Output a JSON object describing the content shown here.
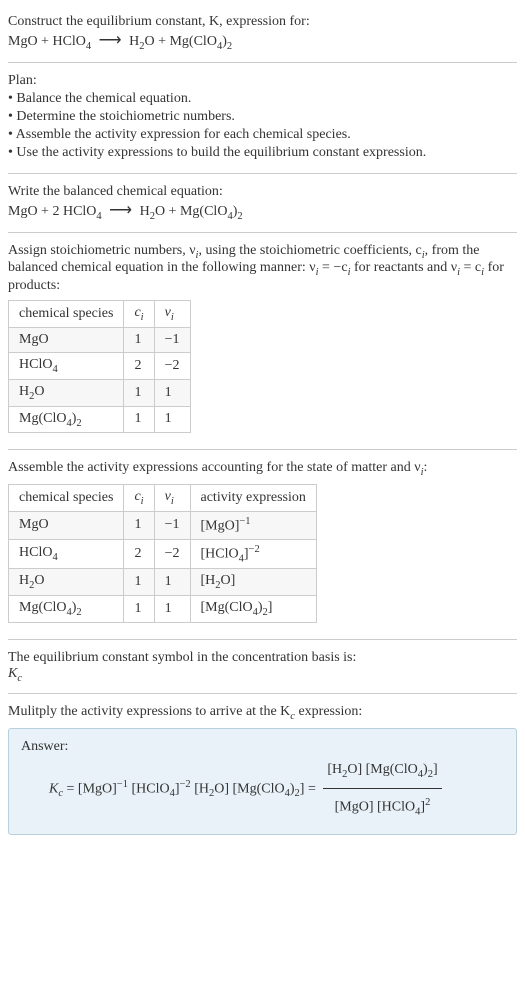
{
  "header": {
    "construct_line": "Construct the equilibrium constant, K, expression for:",
    "equation_lhs_1": "MgO + HClO",
    "equation_rhs_1": "H",
    "equation_rhs_2": "O + Mg(ClO",
    "equation_rhs_3": ")"
  },
  "plan": {
    "title": "Plan:",
    "b1": "• Balance the chemical equation.",
    "b2": "• Determine the stoichiometric numbers.",
    "b3": "• Assemble the activity expression for each chemical species.",
    "b4": "• Use the activity expressions to build the equilibrium constant expression."
  },
  "balanced": {
    "intro": "Write the balanced chemical equation:",
    "lhs": "MgO + 2 HClO",
    "rhs1": "H",
    "rhs2": "O + Mg(ClO",
    "rhs3": ")"
  },
  "assign": {
    "text1": "Assign stoichiometric numbers, ν",
    "text2": ", using the stoichiometric coefficients, c",
    "text3": ", from the balanced chemical equation in the following manner: ν",
    "text4": " = −c",
    "text5": " for reactants and ν",
    "text6": " = c",
    "text7": " for products:"
  },
  "table1": {
    "h1": "chemical species",
    "h2": "c",
    "h3": "ν",
    "rows": [
      {
        "sp": "MgO",
        "c": "1",
        "v": "−1"
      },
      {
        "sp": "HClO",
        "c": "2",
        "v": "−2"
      },
      {
        "sp": "H",
        "c": "1",
        "v": "1"
      },
      {
        "sp": "Mg(ClO",
        "c": "1",
        "v": "1"
      }
    ]
  },
  "assemble": {
    "text1": "Assemble the activity expressions accounting for the state of matter and ν",
    "text2": ":"
  },
  "table2": {
    "h1": "chemical species",
    "h2": "c",
    "h3": "ν",
    "h4": "activity expression",
    "rows": [
      {
        "sp": "MgO",
        "c": "1",
        "v": "−1",
        "ae_base": "[MgO]",
        "ae_exp": "−1"
      },
      {
        "sp": "HClO",
        "c": "2",
        "v": "−2",
        "ae_base": "[HClO",
        "ae_exp": "−2"
      },
      {
        "sp": "H",
        "c": "1",
        "v": "1",
        "ae_base": "[H",
        "ae_exp": ""
      },
      {
        "sp": "Mg(ClO",
        "c": "1",
        "v": "1",
        "ae_base": "[Mg(ClO",
        "ae_exp": ""
      }
    ]
  },
  "symbol": {
    "line1": "The equilibrium constant symbol in the concentration basis is:",
    "kc": "K"
  },
  "multiply": {
    "text1": "Mulitply the activity expressions to arrive at the K",
    "text2": " expression:"
  },
  "answer": {
    "label": "Answer:",
    "kc": "K",
    "eq": " = [MgO]",
    "exp1": "−1",
    "mid1": " [HClO",
    "exp2": "−2",
    "mid2": " [H",
    "mid3": "O] [Mg(ClO",
    "mid4": ")",
    "mid5": "] = ",
    "num1": "[H",
    "num2": "O] [Mg(ClO",
    "num3": ")",
    "num4": "]",
    "den1": "[MgO] [HClO",
    "den2": "]",
    "denexp": "2"
  }
}
